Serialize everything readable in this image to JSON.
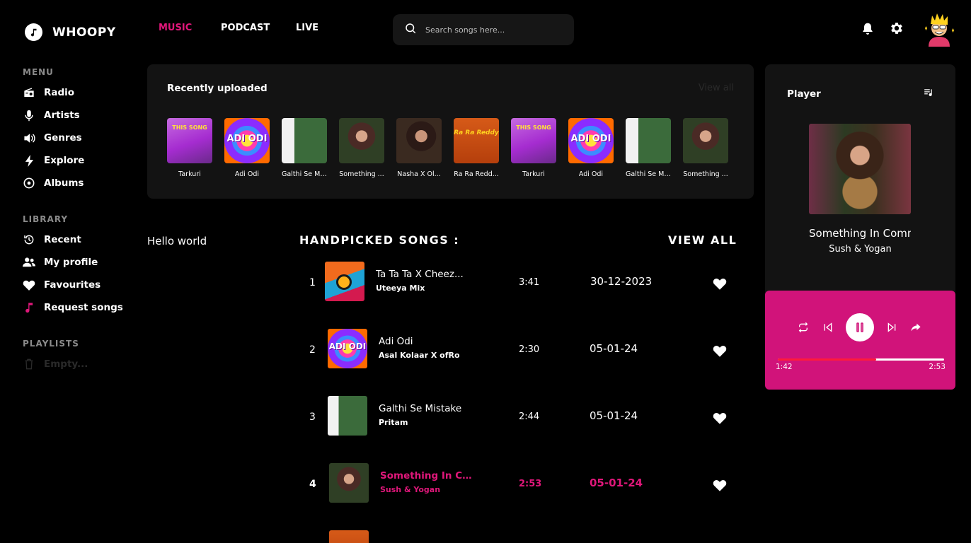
{
  "brand": {
    "name": "WHOOPY"
  },
  "nav": {
    "tabs": [
      {
        "label": "MUSIC",
        "active": true
      },
      {
        "label": "PODCAST"
      },
      {
        "label": "LIVE"
      }
    ]
  },
  "search": {
    "placeholder": "Search songs here..."
  },
  "header_icons": [
    "bell-icon",
    "gear-icon",
    "avatar"
  ],
  "sidebar": {
    "menu_label": "MENU",
    "menu": [
      {
        "label": "Radio",
        "icon": "radio-icon"
      },
      {
        "label": "Artists",
        "icon": "microphone-icon"
      },
      {
        "label": "Genres",
        "icon": "speaker-icon"
      },
      {
        "label": "Explore",
        "icon": "bolt-icon"
      },
      {
        "label": "Albums",
        "icon": "disc-icon"
      }
    ],
    "library_label": "LIBRARY",
    "library": [
      {
        "label": "Recent",
        "icon": "history-icon"
      },
      {
        "label": "My profile",
        "icon": "users-icon"
      },
      {
        "label": "Favourites",
        "icon": "heart-icon"
      },
      {
        "label": "Request songs",
        "icon": "music-note-icon",
        "accent": "#e0177a"
      }
    ],
    "playlists_label": "PLAYLISTS",
    "playlists_empty": "Empty..."
  },
  "recent": {
    "title": "Recently uploaded",
    "view_all": "View all",
    "items": [
      {
        "caption": "Tarkuri",
        "art": "THIS SONG"
      },
      {
        "caption": "Adi Odi",
        "art": "ADI ODI"
      },
      {
        "caption": "Galthi Se Mi...",
        "art": ""
      },
      {
        "caption": "Something ...",
        "art": ""
      },
      {
        "caption": "Nasha X Ol...",
        "art": ""
      },
      {
        "caption": "Ra Ra Redd...",
        "art": "Ra Ra Reddy"
      },
      {
        "caption": "Tarkuri",
        "art": "THIS SONG"
      },
      {
        "caption": "Adi Odi",
        "art": "ADI ODI"
      },
      {
        "caption": "Galthi Se Mi...",
        "art": ""
      },
      {
        "caption": "Something ...",
        "art": ""
      }
    ]
  },
  "main": {
    "hello": "Hello world",
    "handpicked_title": "HANDPICKED SONGS :",
    "view_all": "VIEW ALL",
    "songs": [
      {
        "num": "1",
        "title": "Ta Ta Ta X Cheez...",
        "artist": "Uteeya Mix",
        "duration": "3:41",
        "date": "30-12-2023"
      },
      {
        "num": "2",
        "title": "Adi Odi",
        "artist": "Asal Kolaar X ofRo",
        "duration": "2:30",
        "date": "05-01-24"
      },
      {
        "num": "3",
        "title": "Galthi Se Mistake",
        "artist": "Pritam",
        "duration": "2:44",
        "date": "05-01-24"
      },
      {
        "num": "4",
        "title": "Something In Co...",
        "artist": "Sush & Yogan",
        "duration": "2:53",
        "date": "05-01-24",
        "active": true
      }
    ]
  },
  "player": {
    "title": "Player",
    "song_title": "Something In Common",
    "artist": "Sush & Yogan",
    "current_time": "1:42",
    "total_time": "2:53",
    "progress": 0.59,
    "accent": "#d1137a"
  }
}
